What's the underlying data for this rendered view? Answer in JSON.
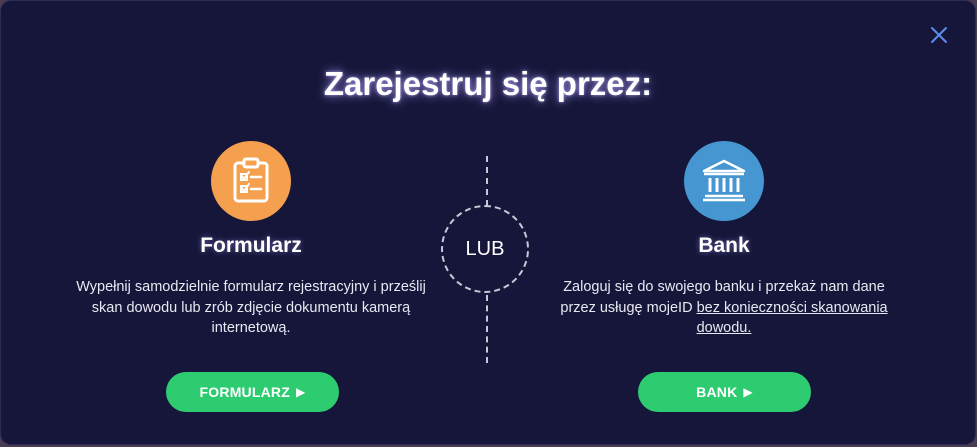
{
  "dialog": {
    "title": "Zarejestruj się przez:",
    "close_icon": "close-icon",
    "divider_label": "LUB"
  },
  "options": {
    "form": {
      "icon": "clipboard-checklist-icon",
      "icon_color": "#f5a04f",
      "title": "Formularz",
      "description": "Wypełnij samodzielnie formularz rejestracyjny i prześlij skan dowodu lub zrób zdjęcie dokumentu kamerą internetową.",
      "button_label": "FORMULARZ",
      "button_arrow": "▶"
    },
    "bank": {
      "icon": "bank-building-icon",
      "icon_color": "#4596d1",
      "title": "Bank",
      "description_prefix": "Zaloguj się do swojego banku i przekaż nam dane przez usługę mojeID ",
      "description_link": "bez konieczności skanowania dowodu.",
      "button_label": "BANK",
      "button_arrow": "▶"
    }
  },
  "colors": {
    "background": "#16163a",
    "button": "#2ecc71",
    "close": "#5b8ee6"
  }
}
